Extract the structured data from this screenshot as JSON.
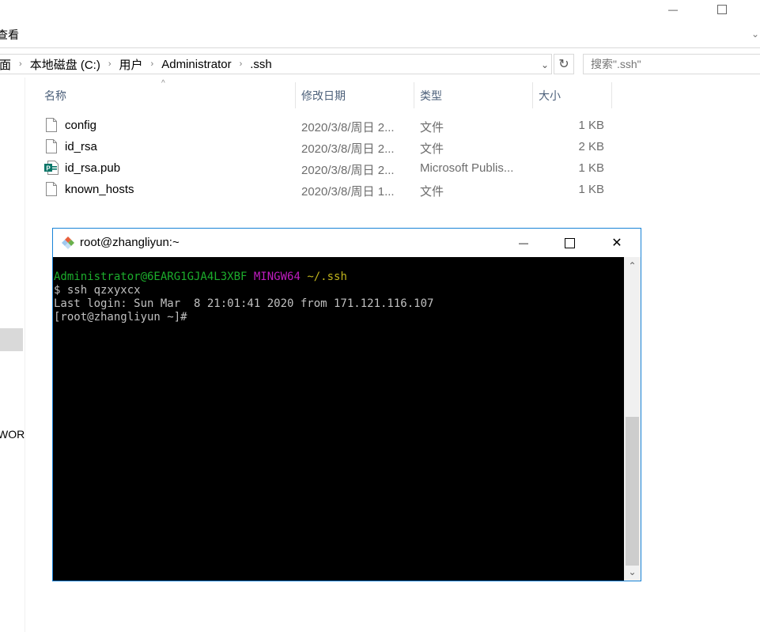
{
  "explorer": {
    "window_controls": {
      "minimize": "—",
      "maximize": "☐"
    },
    "ribbon_tab": "查看",
    "ribbon_expand_icon": "chevron-down-icon",
    "breadcrumb": {
      "prefix_fragment": "面",
      "items": [
        "本地磁盘 (C:)",
        "用户",
        "Administrator",
        ".ssh"
      ],
      "separator": "›"
    },
    "address_dropdown_icon": "⌄",
    "refresh_icon": "↻",
    "search": {
      "placeholder": "搜索\".ssh\""
    },
    "nav": {
      "partial_item": "WOR"
    },
    "columns": [
      {
        "label": "名称"
      },
      {
        "label": "修改日期"
      },
      {
        "label": "类型"
      },
      {
        "label": "大小"
      }
    ],
    "sort_indicator": "^",
    "files": [
      {
        "name": "config",
        "modified": "2020/3/8/周日 2...",
        "type": "文件",
        "size": "1 KB",
        "icon": "file-icon"
      },
      {
        "name": "id_rsa",
        "modified": "2020/3/8/周日 2...",
        "type": "文件",
        "size": "2 KB",
        "icon": "file-icon"
      },
      {
        "name": "id_rsa.pub",
        "modified": "2020/3/8/周日 2...",
        "type": "Microsoft Publis...",
        "size": "1 KB",
        "icon": "publisher-file-icon"
      },
      {
        "name": "known_hosts",
        "modified": "2020/3/8/周日 1...",
        "type": "文件",
        "size": "1 KB",
        "icon": "file-icon"
      }
    ]
  },
  "terminal": {
    "title": "root@zhangliyun:~",
    "controls": {
      "minimize": "—",
      "maximize": "☐",
      "close": "✕"
    },
    "lines": {
      "prompt_user": "Administrator@6EARG1GJA4L3XBF",
      "prompt_env": "MINGW64",
      "prompt_path": "~/.ssh",
      "command": "$ ssh qzxyxcx",
      "last_login": "Last login: Sun Mar  8 21:01:41 2020 from 171.121.116.107",
      "remote_prompt": "[root@zhangliyun ~]#"
    },
    "colors": {
      "user": "#1cad2c",
      "env": "#c01cc0",
      "path": "#c0b41c",
      "text": "#c0c0c0",
      "border": "#1883d7"
    },
    "scroll_position_fraction": 1.0
  }
}
